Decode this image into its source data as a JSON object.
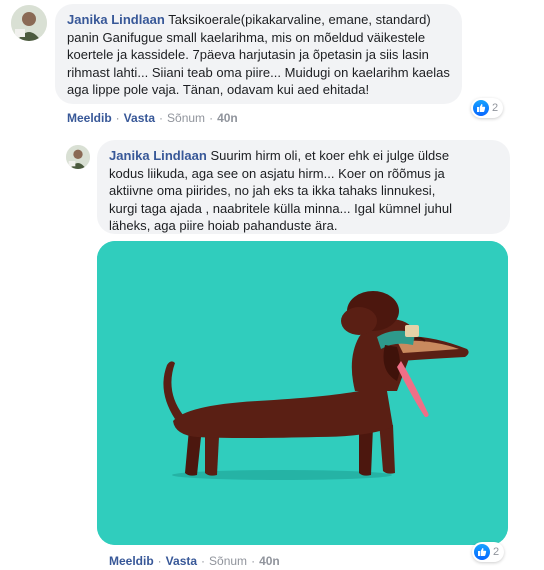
{
  "comments": [
    {
      "author": "Janika Lindlaan",
      "text": "Taksikoerale(pikakarvaline, emane, standard)\npanin Ganifugue small kaelarihma, mis on mõeldud väikestele\nkoertele ja kassidele. 7päeva harjutasin ja õpetasin ja siis lasin\nrihmast lahti... Siiani teab oma piire... Muidugi on kaelarihm kaelas\naga lippe pole vaja. Tänan, odavam kui aed ehitada!",
      "actions": {
        "like": "Meeldib",
        "reply": "Vasta",
        "message": "Sõnum",
        "time": "40n"
      },
      "reaction_count": "2",
      "reaction_icon": "thumbs-up-icon"
    },
    {
      "author": "Janika Lindlaan",
      "text": "Suurim hirm oli, et koer ehk ei julge üldse\nkodus liikuda, aga see on asjatu hirm... Koer on rõõmus ja\naktiivne oma piirides, no jah eks ta ikka tahaks linnukesi,\nkurgi taga ajada , naabritele külla minna... Igal kümnel juhul\nläheks, aga piire hoiab pahanduste ära.",
      "attachment": "dachshund-gif",
      "actions": {
        "like": "Meeldib",
        "reply": "Vasta",
        "message": "Sõnum",
        "time": "40n"
      },
      "reaction_count": "2",
      "reaction_icon": "thumbs-up-icon"
    }
  ],
  "colors": {
    "author": "#385898",
    "bubble": "#f2f3f5",
    "gif_background": "#30cdbd",
    "dog_body": "#5a1f14",
    "like_blue": "#1877f2"
  },
  "separator": "·"
}
